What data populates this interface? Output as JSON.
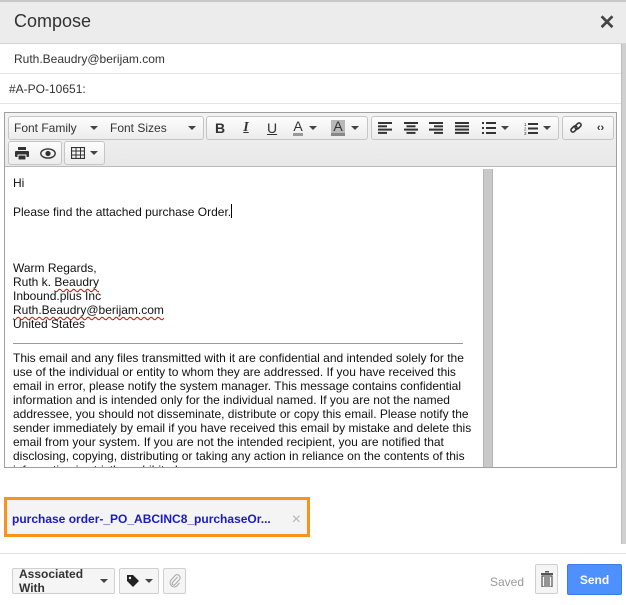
{
  "dialog": {
    "title": "Compose",
    "close_icon": "close-icon"
  },
  "fields": {
    "to": "Ruth.Beaudry@berijam.com",
    "subject": "#A-PO-10651:"
  },
  "toolbar": {
    "font_family_label": "Font Family",
    "font_sizes_label": "Font Sizes",
    "bold": "B",
    "italic": "I",
    "underline": "U",
    "text_color": "A",
    "bg_color": "A",
    "icons": [
      "bold-icon",
      "italic-icon",
      "underline-icon",
      "text-color-icon",
      "background-color-icon",
      "align-left-icon",
      "align-center-icon",
      "align-right-icon",
      "align-justify-icon",
      "bullet-list-icon",
      "numbered-list-icon",
      "link-icon",
      "source-code-icon",
      "print-icon",
      "preview-icon",
      "table-icon"
    ]
  },
  "body": {
    "greeting": "Hi",
    "line1": "Please find the attached purchase Order.",
    "signature": {
      "closing": "Warm Regards,",
      "name_first": "Ruth k. ",
      "name_last": "Beaudry",
      "company": "Inbound.plus Inc",
      "email": "Ruth.Beaudry@berijam.com",
      "country": "United States"
    },
    "disclaimer": "This email and any files transmitted with it are confidential and intended solely for the use of the individual or entity to whom they are addressed. If you have received this email in error, please notify the system manager. This message contains confidential information and is intended only for the individual named. If you are not the named addressee, you should not disseminate, distribute or copy this email. Please notify the sender immediately by email if you have received this email by mistake and delete this email from your system. If you are not the intended recipient, you are notified that disclosing, copying, distributing or taking any action in reliance on the contents of this information is strictly prohibited."
  },
  "attachment": {
    "name": "purchase order-_PO_ABCINC8_purchaseOr...",
    "remove_label": "×"
  },
  "footer": {
    "associated_with": "Associated With",
    "saved_status": "Saved",
    "send": "Send"
  },
  "colors": {
    "send_button": "#4d90fe",
    "attachment_border": "#f7941d",
    "attachment_link": "#1a1acc"
  }
}
